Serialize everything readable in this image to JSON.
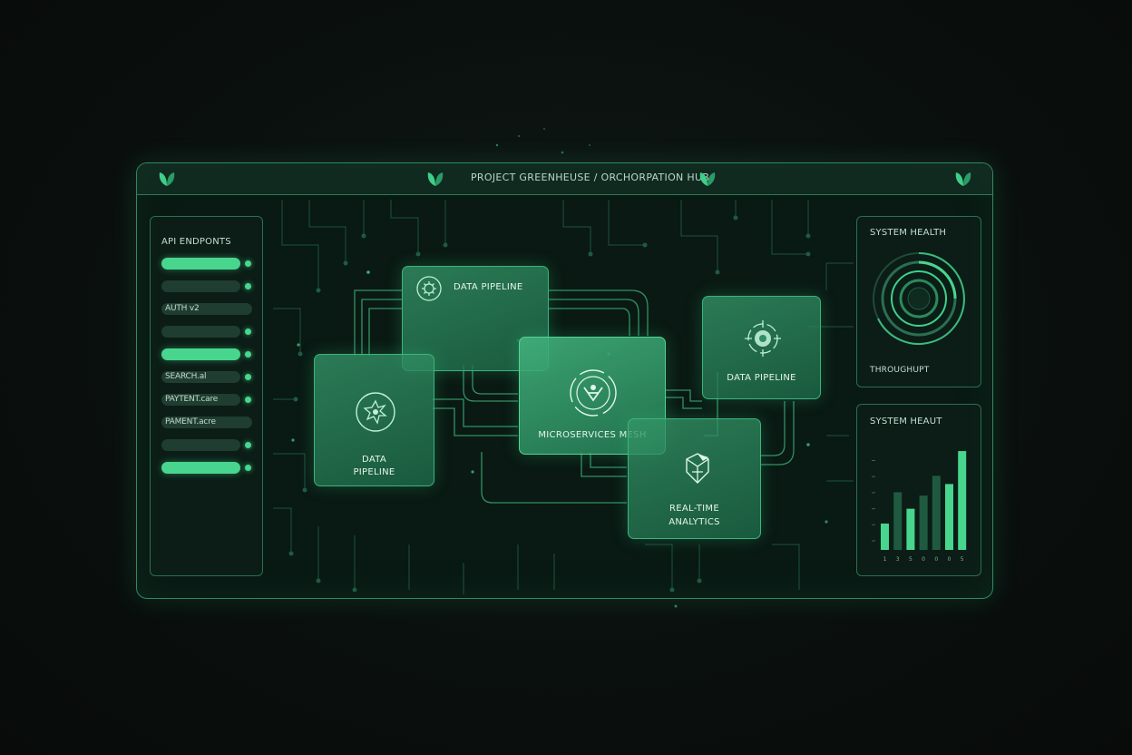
{
  "header": {
    "title": "PROJECT GREENHEUSE / ORCHORPATION HUB",
    "icons": [
      "leaf-icon",
      "leaf-icon",
      "leaf-icon",
      "leaf-icon"
    ]
  },
  "left_panel": {
    "title": "API ENDPONTS",
    "endpoints": [
      {
        "label": "",
        "active": true,
        "dot": true
      },
      {
        "label": "",
        "active": false,
        "dot": true
      },
      {
        "label": "AUTH v2",
        "active": false,
        "dot": false
      },
      {
        "label": "",
        "active": false,
        "dot": true
      },
      {
        "label": "",
        "active": true,
        "dot": true
      },
      {
        "label": "SEARCH.al",
        "active": false,
        "dot": true
      },
      {
        "label": "PAYTENT.care",
        "active": false,
        "dot": true
      },
      {
        "label": "PAMENT.acre",
        "active": false,
        "dot": false
      },
      {
        "label": "",
        "active": false,
        "dot": true
      },
      {
        "label": "",
        "active": true,
        "dot": true
      }
    ]
  },
  "nodes": {
    "top": "DATA PIPELINE",
    "left_line1": "DATA",
    "left_line2": "PIPELINE",
    "center": "MICROSERVICES MESH",
    "right": "DATA PIPELINE",
    "bottom_line1": "REAL-TIME",
    "bottom_line2": "ANALYTICS"
  },
  "health_panel": {
    "title": "SYSTEM HEALTH",
    "footer": "THROUGHUPT"
  },
  "chart_panel": {
    "title": "SYSTEM HEAUT"
  },
  "chart_data": {
    "type": "bar",
    "title": "SYSTEM HEAUT",
    "categories": [
      "1",
      "3",
      "5",
      "0",
      "0",
      "0",
      "5"
    ],
    "values": [
      16,
      35,
      25,
      33,
      45,
      40,
      60
    ],
    "series_highlight": [
      true,
      false,
      true,
      false,
      false,
      true,
      true
    ],
    "ylim": [
      0,
      65
    ],
    "colors": {
      "bright": "#48d68e",
      "dark": "#1f5a40"
    }
  },
  "colors": {
    "accent": "#48d68e",
    "border": "#2f8a62",
    "background": "#0a100e"
  }
}
